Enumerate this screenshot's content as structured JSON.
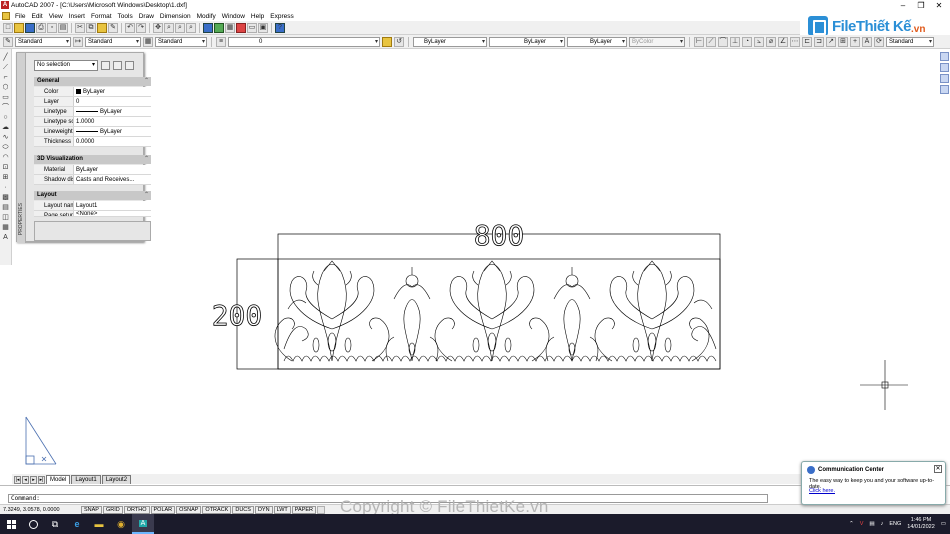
{
  "window": {
    "title": "AutoCAD 2007 - [C:\\Users\\Microsoft Windows\\Desktop\\1.dxf]"
  },
  "menu": [
    "File",
    "Edit",
    "View",
    "Insert",
    "Format",
    "Tools",
    "Draw",
    "Dimension",
    "Modify",
    "Window",
    "Help",
    "Express"
  ],
  "styles": {
    "text_style": "Standard",
    "dim_style": "Standard",
    "table_style": "Standard",
    "ml_style": "Standard"
  },
  "layers": {
    "current": "0"
  },
  "props_toolbar": {
    "color": "ByLayer",
    "linetype": "ByLayer",
    "lineweight": "ByLayer",
    "plotstyle": "ByColor"
  },
  "logo": {
    "text": "FileThiết Kế",
    "suffix": ".vn"
  },
  "properties": {
    "selection": "No selection",
    "palette_label": "PROPERTIES",
    "sections": [
      {
        "title": "General",
        "rows": [
          {
            "key": "Color",
            "value": "ByLayer",
            "swatch": true
          },
          {
            "key": "Layer",
            "value": "0"
          },
          {
            "key": "Linetype",
            "value": "ByLayer",
            "line": true
          },
          {
            "key": "Linetype sc...",
            "value": "1.0000"
          },
          {
            "key": "Lineweight",
            "value": "ByLayer",
            "line": true
          },
          {
            "key": "Thickness",
            "value": "0.0000"
          }
        ]
      },
      {
        "title": "3D Visualization",
        "rows": [
          {
            "key": "Material",
            "value": "ByLayer"
          },
          {
            "key": "Shadow dis...",
            "value": "Casts and Receives..."
          }
        ]
      },
      {
        "title": "Layout",
        "rows": [
          {
            "key": "Layout name",
            "value": "Layout1"
          },
          {
            "key": "Page setup",
            "value": "<None>"
          }
        ]
      }
    ]
  },
  "drawing": {
    "dim_width": "800",
    "dim_height": "200"
  },
  "layout_tabs": [
    "Model",
    "Layout1",
    "Layout2"
  ],
  "command": {
    "prompt": "Command:"
  },
  "status": {
    "coords": "7.3249, 3.0578, 0.0000",
    "toggles": [
      "SNAP",
      "GRID",
      "ORTHO",
      "POLAR",
      "OSNAP",
      "OTRACK",
      "DUCS",
      "DYN",
      "LWT",
      "PAPER"
    ]
  },
  "notification": {
    "title": "Communication Center",
    "body": "The easy way to keep you and your software up-to-date.",
    "link": "Click here."
  },
  "watermark": "Copyright © FileThietKe.vn",
  "taskbar": {
    "lang": "ENG",
    "time": "1:46 PM",
    "date": "14/01/2022"
  }
}
